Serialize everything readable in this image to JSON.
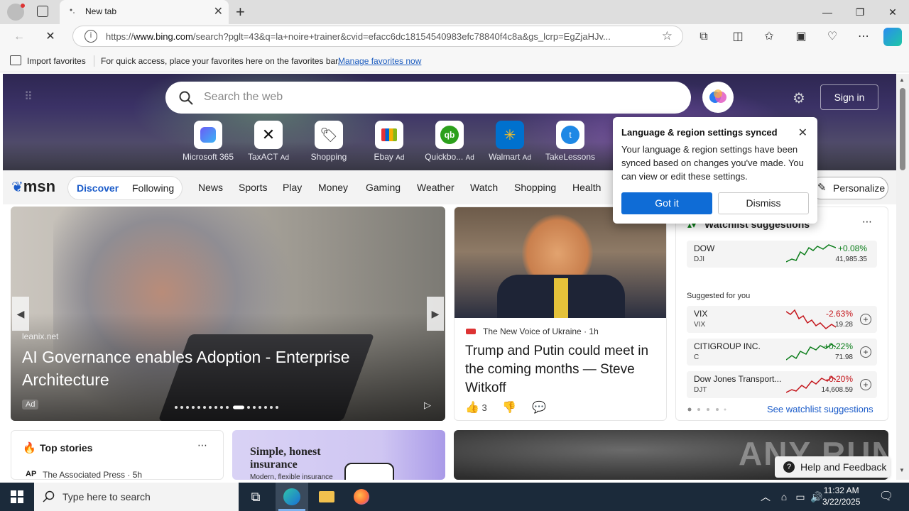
{
  "browser": {
    "tab_title": "New tab",
    "url_prefix": "https://",
    "url_host": "www.bing.com",
    "url_rest": "/search?pglt=43&q=la+noire+trainer&cvid=efacc6dc18154540983efc78840f4c8a&gs_lcrp=EgZjaHJv...",
    "favbar": {
      "import_label": "Import favorites",
      "message": "For quick access, place your favorites here on the favorites bar.",
      "manage_link": "Manage favorites now"
    }
  },
  "hero": {
    "search_placeholder": "Search the web",
    "sign_in": "Sign in",
    "quick_links": [
      {
        "label": "Microsoft 365",
        "ad": "",
        "color": "#7a5af5"
      },
      {
        "label": "TaxACT",
        "ad": "Ad",
        "color": "#1a1a1a"
      },
      {
        "label": "Shopping",
        "ad": "",
        "color": "#444444"
      },
      {
        "label": "Ebay",
        "ad": "Ad",
        "color": "#e53238"
      },
      {
        "label": "Quickbo...",
        "ad": "Ad",
        "color": "#2ca01c"
      },
      {
        "label": "Walmart",
        "ad": "Ad",
        "color": "#0071ce"
      },
      {
        "label": "TakeLessons",
        "ad": "",
        "color": "#1e88e5"
      }
    ]
  },
  "msn": {
    "logo": "msn",
    "discover": "Discover",
    "following": "Following",
    "nav": [
      "News",
      "Sports",
      "Play",
      "Money",
      "Gaming",
      "Weather",
      "Watch",
      "Shopping",
      "Health"
    ],
    "personalize": "Personalize"
  },
  "popup": {
    "title": "Language & region settings synced",
    "body": "Your language & region settings have been synced based on changes you've made. You can view or edit these settings.",
    "got_it": "Got it",
    "dismiss": "Dismiss"
  },
  "main_card": {
    "source": "leanix.net",
    "headline": "AI Governance enables Adoption - Enterprise Architecture",
    "ad": "Ad"
  },
  "news_card": {
    "source": "The New Voice of Ukraine",
    "time": "1h",
    "headline": "Trump and Putin could meet in the coming months — Steve Witkoff",
    "likes": "3"
  },
  "watchlist": {
    "title": "Watchlist suggestions",
    "suggested": "Suggested for you",
    "see_more": "See watchlist suggestions",
    "primary": {
      "name": "DOW",
      "symbol": "DJI",
      "change": "+0.08%",
      "price": "41,985.35",
      "dir": "pos"
    },
    "stocks": [
      {
        "name": "VIX",
        "symbol": "VIX",
        "change": "-2.63%",
        "price": "19.28",
        "dir": "neg"
      },
      {
        "name": "CITIGROUP INC.",
        "symbol": "C",
        "change": "+0.22%",
        "price": "71.98",
        "dir": "pos"
      },
      {
        "name": "Dow Jones Transport...",
        "symbol": "DJT",
        "change": "-0.20%",
        "price": "14,608.59",
        "dir": "neg"
      }
    ]
  },
  "row2": {
    "top_stories": "Top stories",
    "top_source": "The Associated Press · 5h",
    "insurance_headline": "Simple, honest insurance",
    "insurance_sub": "Modern, flexible insurance",
    "help": "Help and Feedback",
    "watermark": "ANY RUN"
  },
  "taskbar": {
    "search_placeholder": "Type here to search",
    "time": "11:32 AM",
    "date": "3/22/2025"
  }
}
